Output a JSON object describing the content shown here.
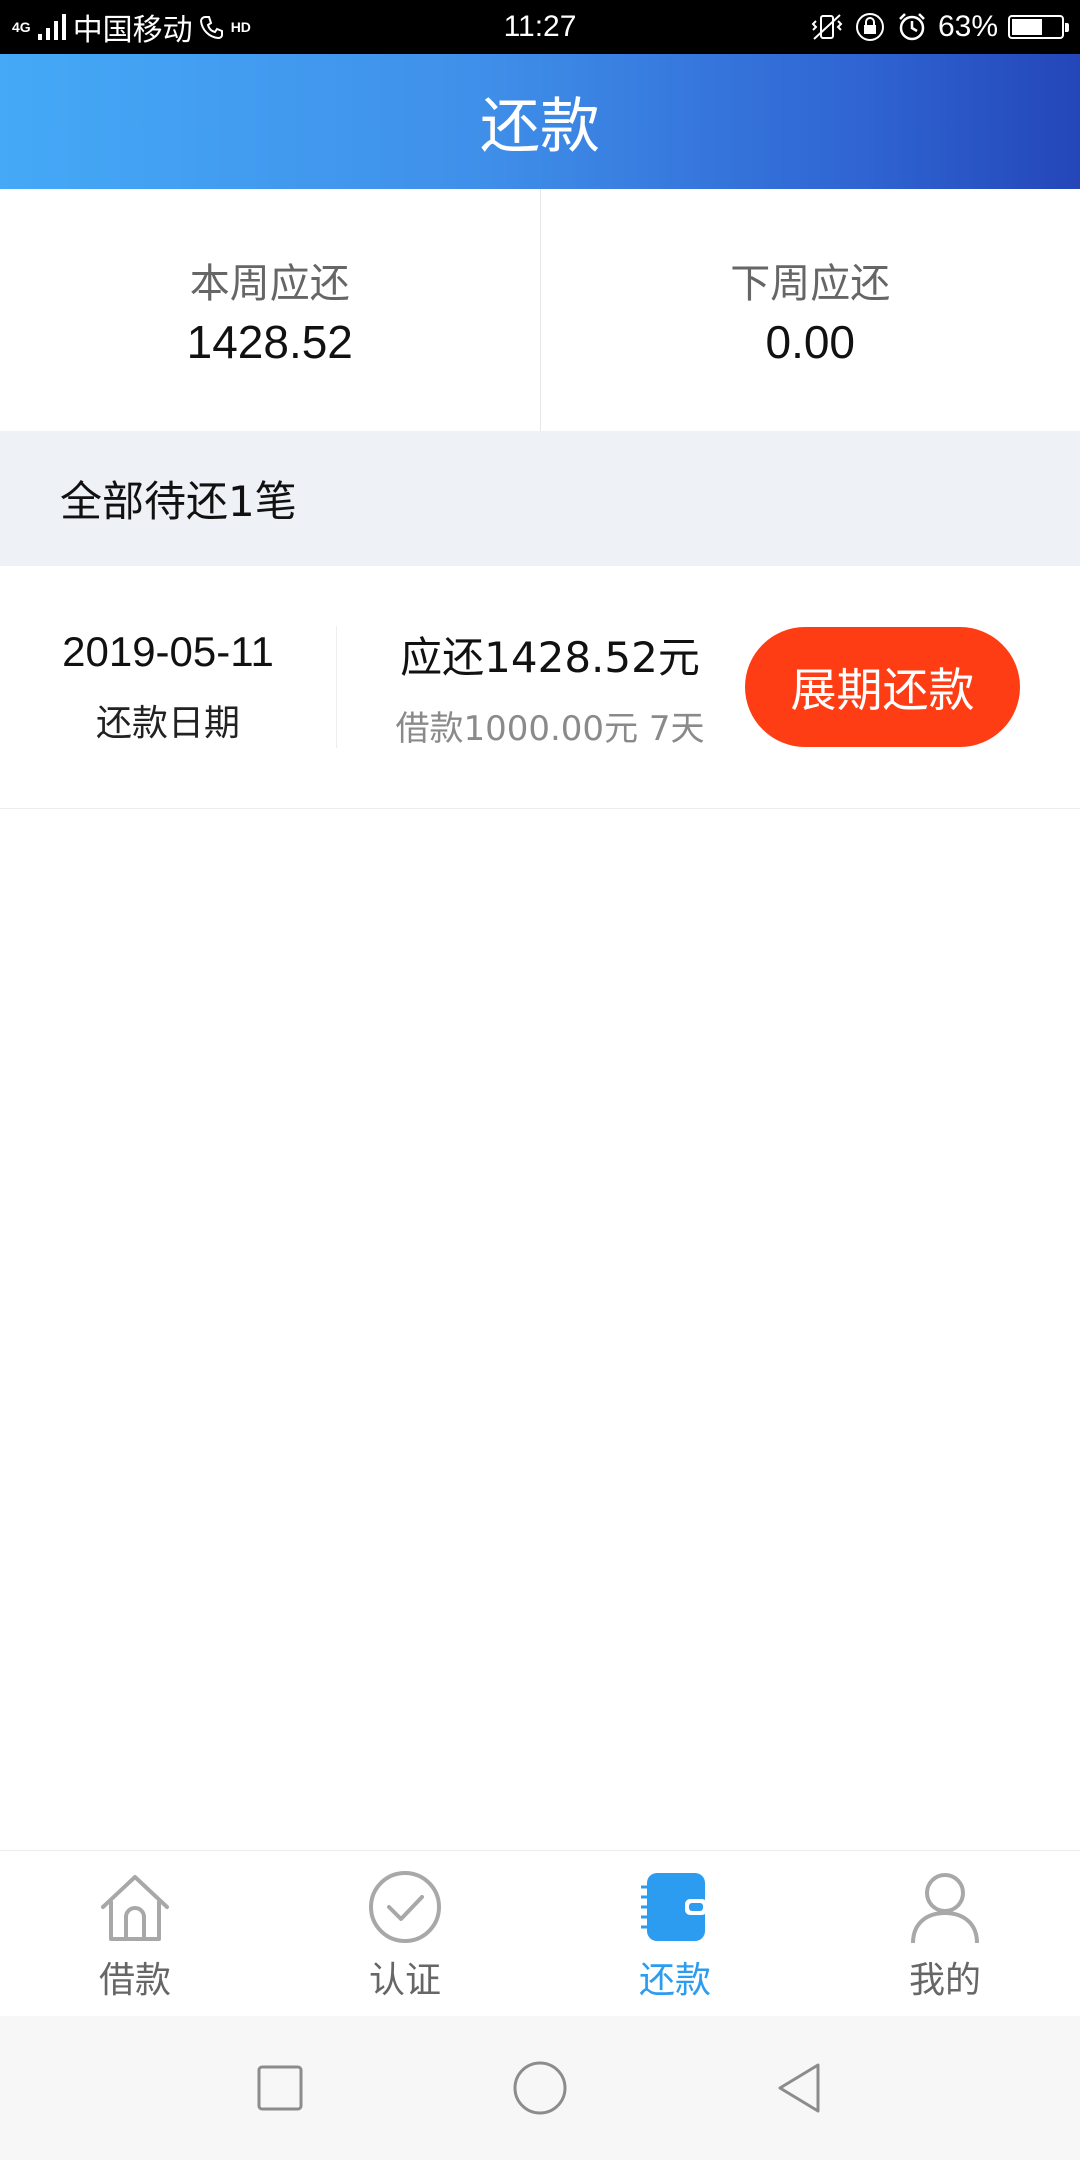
{
  "status_bar": {
    "network": "4G",
    "carrier": "中国移动",
    "hd": "HD",
    "time": "11:27",
    "battery": "63%",
    "battery_level": 0.63,
    "icons": [
      "signal-icon",
      "call-hd-icon",
      "vibrate-icon",
      "lock-rotation-icon",
      "alarm-icon",
      "battery-icon"
    ]
  },
  "header": {
    "title": "还款"
  },
  "summary": {
    "this_week_label": "本周应还",
    "this_week_amount": "1428.52",
    "next_week_label": "下周应还",
    "next_week_amount": "0.00"
  },
  "banner": {
    "text": "全部待还1笔"
  },
  "records": [
    {
      "date": "2019-05-11",
      "date_label": "还款日期",
      "due": "应还1428.52元",
      "info": "借款1000.00元 7天",
      "button": "展期还款"
    }
  ],
  "tabs": [
    {
      "label": "借款",
      "icon": "home-icon",
      "active": false
    },
    {
      "label": "认证",
      "icon": "check-circle-icon",
      "active": false
    },
    {
      "label": "还款",
      "icon": "wallet-icon",
      "active": true
    },
    {
      "label": "我的",
      "icon": "user-icon",
      "active": false
    }
  ],
  "colors": {
    "header_start": "#45a9f7",
    "header_end": "#2446b8",
    "button": "#ff3d14",
    "tab_active": "#2c9cf0",
    "tab_inactive": "#666666"
  }
}
